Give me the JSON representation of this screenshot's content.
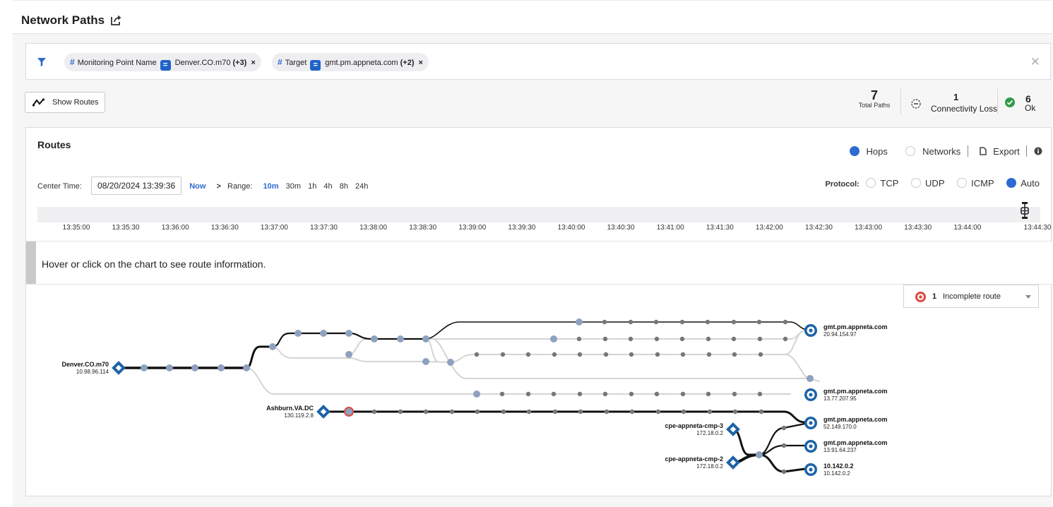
{
  "page": {
    "title": "Network Paths"
  },
  "filters": {
    "chips": [
      {
        "field": "Monitoring Point Name",
        "operator": "=",
        "value": "Denver.CO.m70",
        "more": "(+3)"
      },
      {
        "field": "Target",
        "operator": "=",
        "value": "gmt.pm.appneta.com",
        "more": "(+2)"
      }
    ]
  },
  "toolbar": {
    "show_routes": "Show Routes"
  },
  "summary": {
    "total_paths": {
      "value": "7",
      "label": "Total Paths"
    },
    "connectivity_loss": {
      "value": "1",
      "label": "Connectivity Loss"
    },
    "ok": {
      "value": "6",
      "label": "Ok"
    }
  },
  "routes": {
    "title": "Routes",
    "view": {
      "hops": "Hops",
      "networks": "Networks",
      "export": "Export",
      "selected": "Hops"
    },
    "center_time_label": "Center Time:",
    "center_time_value": "08/20/2024 13:39:36",
    "now": "Now",
    "range_label": "Range:",
    "ranges": [
      "10m",
      "30m",
      "1h",
      "4h",
      "8h",
      "24h"
    ],
    "range_selected": "10m",
    "protocol_label": "Protocol:",
    "protocols": [
      "TCP",
      "UDP",
      "ICMP",
      "Auto"
    ],
    "protocol_selected": "Auto",
    "ticks": [
      "13:35:00",
      "13:35:30",
      "13:36:00",
      "13:36:30",
      "13:37:00",
      "13:37:30",
      "13:38:00",
      "13:38:30",
      "13:39:00",
      "13:39:30",
      "13:40:00",
      "13:40:30",
      "13:41:00",
      "13:41:30",
      "13:42:00",
      "13:42:30",
      "13:43:00",
      "13:43:30",
      "13:44:00",
      "13:44:30"
    ],
    "info_text": "Hover or click on the chart to see route information.",
    "incomplete": {
      "count": "1",
      "label": "Incomplete route"
    }
  },
  "graph": {
    "sources": [
      {
        "name": "Denver.CO.m70",
        "ip": "10.98.96.114"
      },
      {
        "name": "Ashburn.VA.DC",
        "ip": "130.119.2.8"
      },
      {
        "name": "cpe-appneta-cmp-3",
        "ip": "172.18.0.2"
      },
      {
        "name": "cpe-appneta-cmp-2",
        "ip": "172.18.0.2"
      }
    ],
    "targets": [
      {
        "name": "gmt.pm.appneta.com",
        "ip": "20.94.154.97"
      },
      {
        "name": "gmt.pm.appneta.com",
        "ip": "13.77.207.95"
      },
      {
        "name": "gmt.pm.appneta.com",
        "ip": "52.149.170.0"
      },
      {
        "name": "gmt.pm.appneta.com",
        "ip": "13.91.64.237"
      },
      {
        "name": "10.142.0.2",
        "ip": "10.142.0.2"
      }
    ],
    "colors": {
      "path": "#111111",
      "faded": "#d4d4d6",
      "hop": "#8da2bf",
      "hop_small": "#777777",
      "node": "#1d63a6",
      "incomplete": "#e0493e"
    }
  }
}
